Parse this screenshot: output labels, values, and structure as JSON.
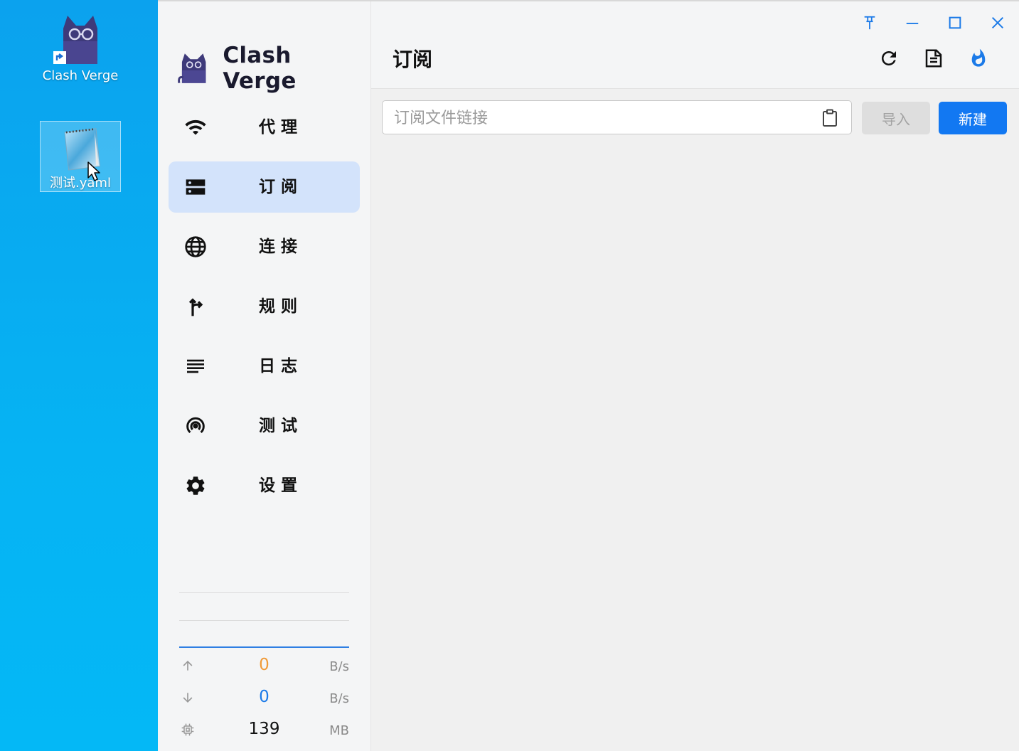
{
  "desktop": {
    "icons": [
      {
        "label": "Clash Verge",
        "icon": "clash-verge-cat-icon"
      },
      {
        "label": "测试.yaml",
        "icon": "notepad-file-icon"
      }
    ]
  },
  "app": {
    "name": "Clash Verge",
    "sidebar": {
      "items": [
        {
          "label": "代理",
          "icon": "wifi-icon",
          "active": false
        },
        {
          "label": "订阅",
          "icon": "storage-icon",
          "active": true
        },
        {
          "label": "连接",
          "icon": "globe-icon",
          "active": false
        },
        {
          "label": "规则",
          "icon": "fork-arrow-icon",
          "active": false
        },
        {
          "label": "日志",
          "icon": "lines-icon",
          "active": false
        },
        {
          "label": "测试",
          "icon": "radar-icon",
          "active": false
        },
        {
          "label": "设置",
          "icon": "gear-icon",
          "active": false
        }
      ]
    },
    "traffic": {
      "upload": {
        "value": "0",
        "unit": "B/s",
        "color": "#f09a37"
      },
      "download": {
        "value": "0",
        "unit": "B/s",
        "color": "#1b7ae8"
      },
      "memory": {
        "value": "139",
        "unit": "MB"
      }
    },
    "header": {
      "title": "订阅"
    },
    "subscription": {
      "url_placeholder": "订阅文件链接",
      "url_value": "",
      "import_label": "导入",
      "new_label": "新建"
    },
    "colors": {
      "accent": "#1278f2",
      "active_nav_bg": "#d3e3fb",
      "window_control": "#1b7ae8"
    }
  }
}
